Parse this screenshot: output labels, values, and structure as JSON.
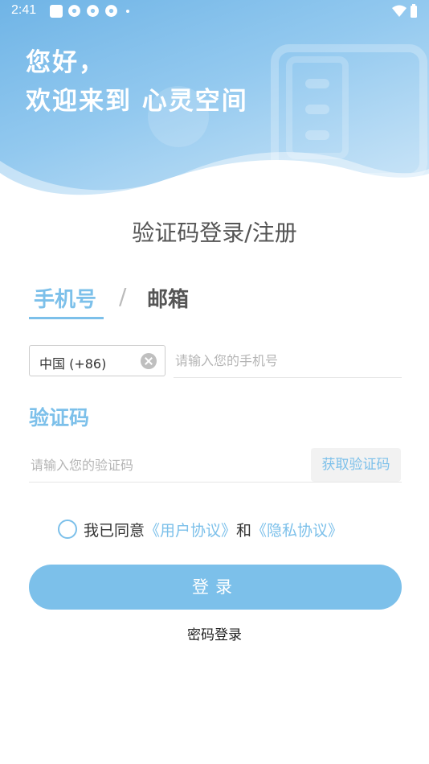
{
  "status_bar": {
    "time": "2:41"
  },
  "header": {
    "greeting_line1": "您好，",
    "greeting_line2": "欢迎来到 心灵空间"
  },
  "title": "验证码登录/注册",
  "tabs": {
    "phone": "手机号",
    "separator": "/",
    "email": "邮箱"
  },
  "phone_form": {
    "country_code": "中国 (+86)",
    "phone_placeholder": "请输入您的手机号"
  },
  "code_form": {
    "label": "验证码",
    "code_placeholder": "请输入您的验证码",
    "get_code_button": "获取验证码"
  },
  "agreement": {
    "prefix": "我已同意",
    "user_agreement": "《用户协议》",
    "and": "和",
    "privacy_agreement": "《隐私协议》"
  },
  "login_button": "登录",
  "password_login_link": "密码登录",
  "colors": {
    "accent": "#7cc0ea",
    "header_start": "#6fb4e6",
    "header_end": "#cfe7f8"
  }
}
